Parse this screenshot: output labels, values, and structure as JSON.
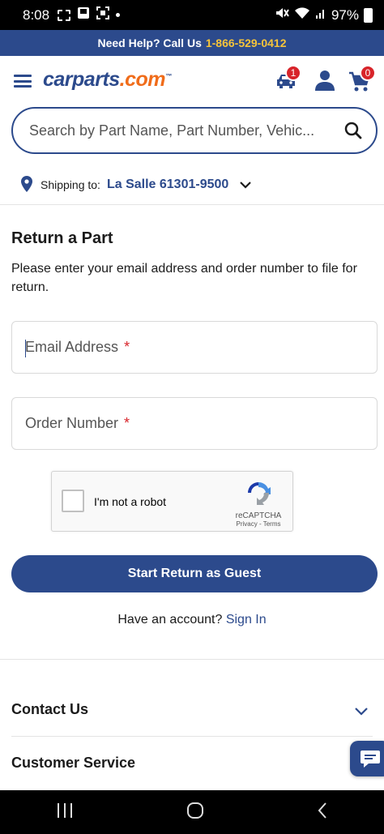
{
  "status_bar": {
    "time": "8:08",
    "battery": "97%",
    "icons": [
      "screenshot-icon",
      "gallery-icon",
      "scan-icon",
      "dot-icon",
      "mute-icon",
      "wifi-icon",
      "signal-icon",
      "battery-icon"
    ]
  },
  "help_bar": {
    "text": "Need Help? Call Us",
    "phone": "1-866-529-0412"
  },
  "header": {
    "logo_main": "carparts",
    "logo_com": ".com",
    "logo_tm": "™",
    "garage_badge": "1",
    "cart_badge": "0"
  },
  "search": {
    "placeholder": "Search by Part Name, Part Number, Vehic..."
  },
  "shipping": {
    "label": "Shipping to:",
    "location": "La Salle 61301-9500"
  },
  "main": {
    "title": "Return a Part",
    "description": "Please enter your email address and order number to file for return.",
    "email_label": "Email Address",
    "order_label": "Order Number",
    "required_mark": "*",
    "captcha_label": "I'm not a robot",
    "captcha_brand": "reCAPTCHA",
    "captcha_links": "Privacy - Terms",
    "cta_label": "Start Return as Guest",
    "account_prompt": "Have an account?",
    "sign_in": "Sign In"
  },
  "footer": {
    "contact": "Contact Us",
    "customer_service": "Customer Service"
  },
  "colors": {
    "brand_blue": "#2c4a8c",
    "brand_orange": "#f06c1a",
    "phone_yellow": "#f6c43a",
    "badge_red": "#d8242a"
  }
}
